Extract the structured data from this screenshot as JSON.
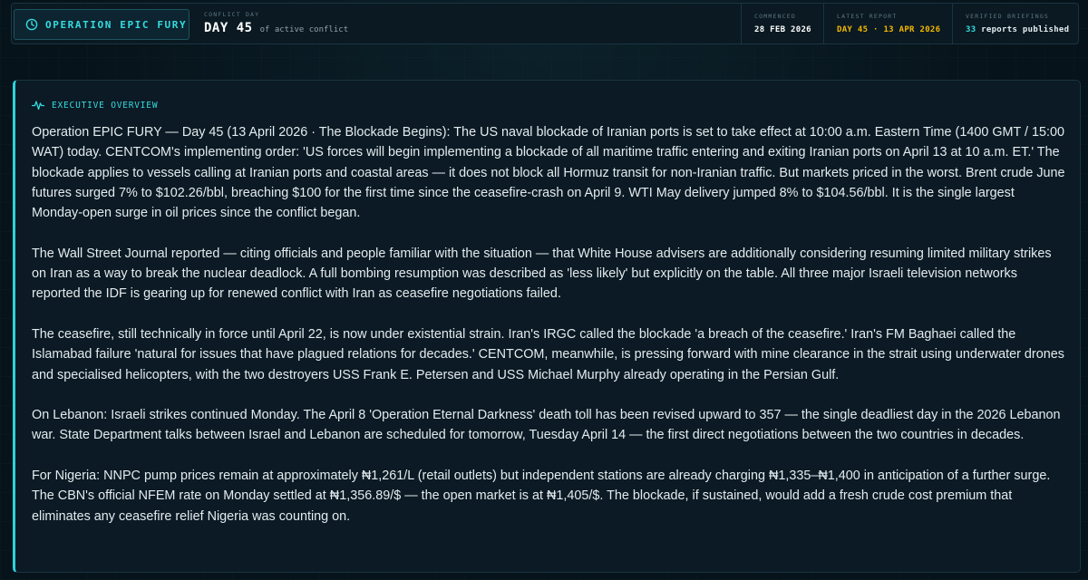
{
  "header": {
    "operation_label": "OPERATION EPIC FURY",
    "conflict_day_label": "CONFLICT DAY",
    "day_value": "DAY 45",
    "day_suffix": "of active conflict",
    "commenced_label": "COMMENCED",
    "commenced_value": "28 FEB 2026",
    "latest_report_label": "LATEST REPORT",
    "latest_report_value": "DAY 45 · 13 APR 2026",
    "verified_briefings_label": "VERIFIED BRIEFINGS",
    "verified_briefings_count": "33",
    "verified_briefings_suffix": "reports published"
  },
  "overview": {
    "title": "EXECUTIVE OVERVIEW",
    "paragraphs": [
      "Operation EPIC FURY — Day 45 (13 April 2026 · The Blockade Begins): The US naval blockade of Iranian ports is set to take effect at 10:00 a.m. Eastern Time (1400 GMT / 15:00 WAT) today. CENTCOM's implementing order: 'US forces will begin implementing a blockade of all maritime traffic entering and exiting Iranian ports on April 13 at 10 a.m. ET.' The blockade applies to vessels calling at Iranian ports and coastal areas — it does not block all Hormuz transit for non-Iranian traffic. But markets priced in the worst. Brent crude June futures surged 7% to $102.26/bbl, breaching $100 for the first time since the ceasefire-crash on April 9. WTI May delivery jumped 8% to $104.56/bbl. It is the single largest Monday-open surge in oil prices since the conflict began.",
      "The Wall Street Journal reported — citing officials and people familiar with the situation — that White House advisers are additionally considering resuming limited military strikes on Iran as a way to break the nuclear deadlock. A full bombing resumption was described as 'less likely' but explicitly on the table. All three major Israeli television networks reported the IDF is gearing up for renewed conflict with Iran as ceasefire negotiations failed.",
      "The ceasefire, still technically in force until April 22, is now under existential strain. Iran's IRGC called the blockade 'a breach of the ceasefire.' Iran's FM Baghaei called the Islamabad failure 'natural for issues that have plagued relations for decades.' CENTCOM, meanwhile, is pressing forward with mine clearance in the strait using underwater drones and specialised helicopters, with the two destroyers USS Frank E. Petersen and USS Michael Murphy already operating in the Persian Gulf.",
      "On Lebanon: Israeli strikes continued Monday. The April 8 'Operation Eternal Darkness' death toll has been revised upward to 357 — the single deadliest day in the 2026 Lebanon war. State Department talks between Israel and Lebanon are scheduled for tomorrow, Tuesday April 14 — the first direct negotiations between the two countries in decades.",
      "For Nigeria: NNPC pump prices remain at approximately ₦1,261/L (retail outlets) but independent stations are already charging ₦1,335–₦1,400 in anticipation of a further surge. The CBN's official NFEM rate on Monday settled at ₦1,356.89/$ — the open market is at ₦1,405/$. The blockade, if sustained, would add a fresh crude cost premium that eliminates any ceasefire relief Nigeria was counting on."
    ]
  },
  "colors": {
    "accent": "#36dbe0",
    "highlight": "#f5b700",
    "background": "#07131b",
    "panel": "#0b1a24"
  },
  "icons": {
    "operation": "clock-icon",
    "overview": "activity-pulse-icon"
  }
}
